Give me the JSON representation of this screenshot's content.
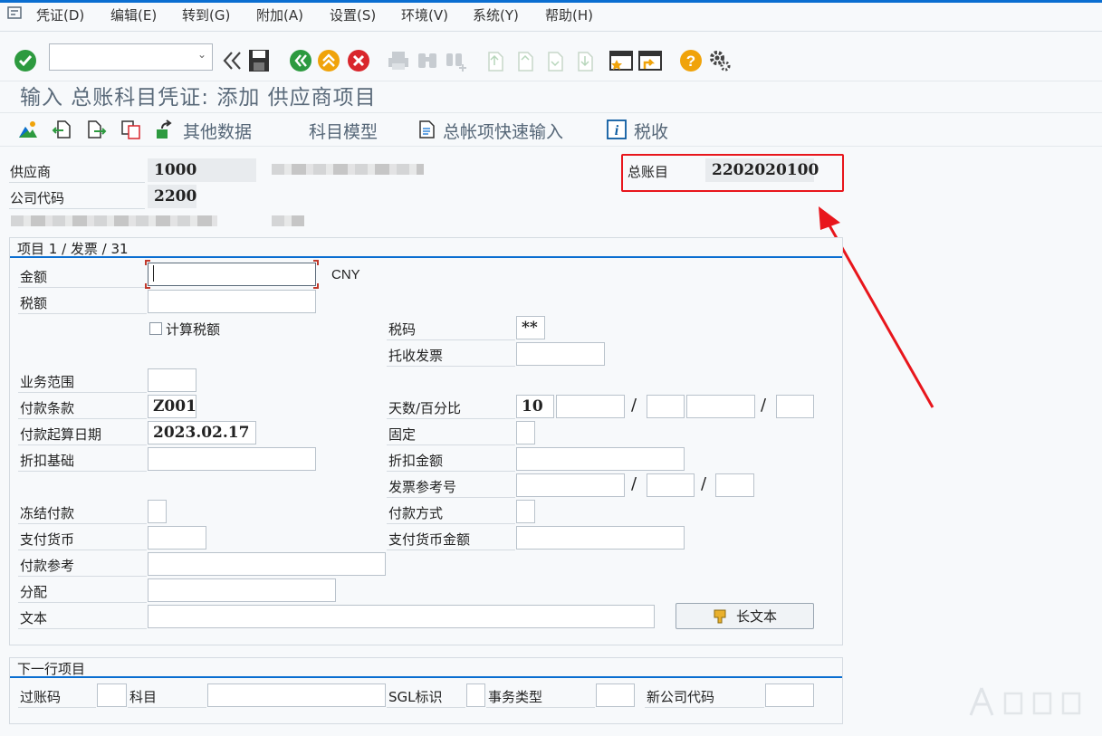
{
  "menu": [
    "凭证(D)",
    "编辑(E)",
    "转到(G)",
    "附加(A)",
    "设置(S)",
    "环境(V)",
    "系统(Y)",
    "帮助(H)"
  ],
  "toolbar": {
    "command_field": "",
    "icons": [
      "enter-check-icon",
      "back-double-arrow-icon",
      "save-icon",
      "back-green-icon",
      "exit-up-icon",
      "cancel-red-icon",
      "print-icon",
      "find-icon",
      "find-next-icon",
      "first-page-icon",
      "previous-page-icon",
      "next-page-icon",
      "last-page-icon",
      "create-session-icon",
      "shortcut-icon",
      "help-icon",
      "customize-layout-icon"
    ]
  },
  "title": "输入 总账科目凭证: 添加 供应商项目",
  "app_toolbar": {
    "other_data": "其他数据",
    "account_model": "科目模型",
    "fast_entry": "总帐项快速输入",
    "tax": "税收"
  },
  "header": {
    "vendor_label": "供应商",
    "vendor_value": "1000",
    "company_code_label": "公司代码",
    "company_code_value": "2200",
    "gl_label": "总账目",
    "gl_value": "2202020100"
  },
  "item_group": {
    "title": "项目 1 / 发票 / 31",
    "amount_label": "金额",
    "amount_value": "",
    "currency": "CNY",
    "tax_amount_label": "税额",
    "calc_tax_label": "计算税额",
    "tax_code_label": "税码",
    "tax_code_value": "**",
    "collection_invoice_label": "托收发票",
    "business_area_label": "业务范围",
    "payment_terms_label": "付款条款",
    "payment_terms_value": "Z001",
    "days_percent_label": "天数/百分比",
    "days_value": "10",
    "baseline_date_label": "付款起算日期",
    "baseline_date_value": "2023.02.17",
    "fixed_label": "固定",
    "discount_base_label": "折扣基础",
    "discount_amount_label": "折扣金额",
    "invoice_ref_label": "发票参考号",
    "payment_block_label": "冻结付款",
    "payment_method_label": "付款方式",
    "payment_currency_label": "支付货币",
    "payment_currency_amount_label": "支付货币金额",
    "payment_ref_label": "付款参考",
    "assignment_label": "分配",
    "text_label": "文本",
    "long_text_button": "长文本",
    "slash": "/"
  },
  "next_item": {
    "title": "下一行项目",
    "posting_key_label": "过账码",
    "account_label": "科目",
    "sgl_label": "SGL标识",
    "trans_type_label": "事务类型",
    "new_company_label": "新公司代码"
  },
  "colors": {
    "accent": "#0a6ed1",
    "highlight": "#e8161c",
    "arrow": "#e8161c"
  }
}
